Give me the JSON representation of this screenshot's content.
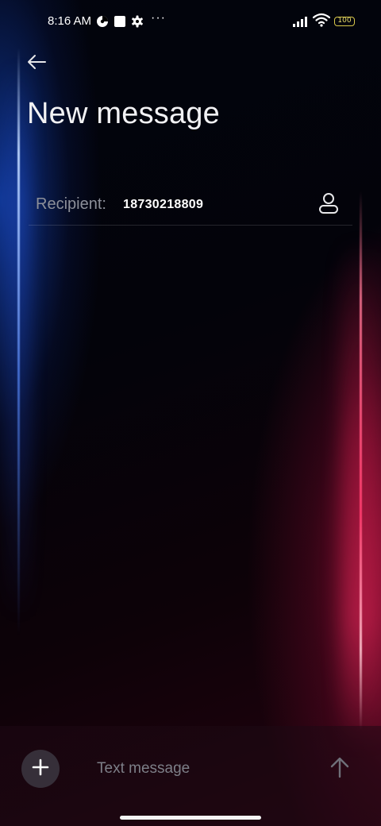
{
  "status_bar": {
    "time": "8:16 AM",
    "more_dots": "···",
    "battery_level": "100",
    "icons": [
      "privacy-shield-icon",
      "square-notification-icon",
      "gear-icon",
      "signal-icon",
      "wifi-icon",
      "battery-icon"
    ]
  },
  "header": {
    "back_icon": "arrow-left-icon",
    "title": "New message"
  },
  "recipient": {
    "label": "Recipient:",
    "value": "18730218809",
    "contact_icon": "person-icon"
  },
  "composer": {
    "add_icon": "plus-icon",
    "placeholder": "Text message",
    "value": "",
    "send_icon": "arrow-up-icon"
  },
  "colors": {
    "title": "#f2f2f4",
    "label": "#8c8f99",
    "accent_blue": "#3c78e6",
    "accent_red": "#e0285a"
  }
}
